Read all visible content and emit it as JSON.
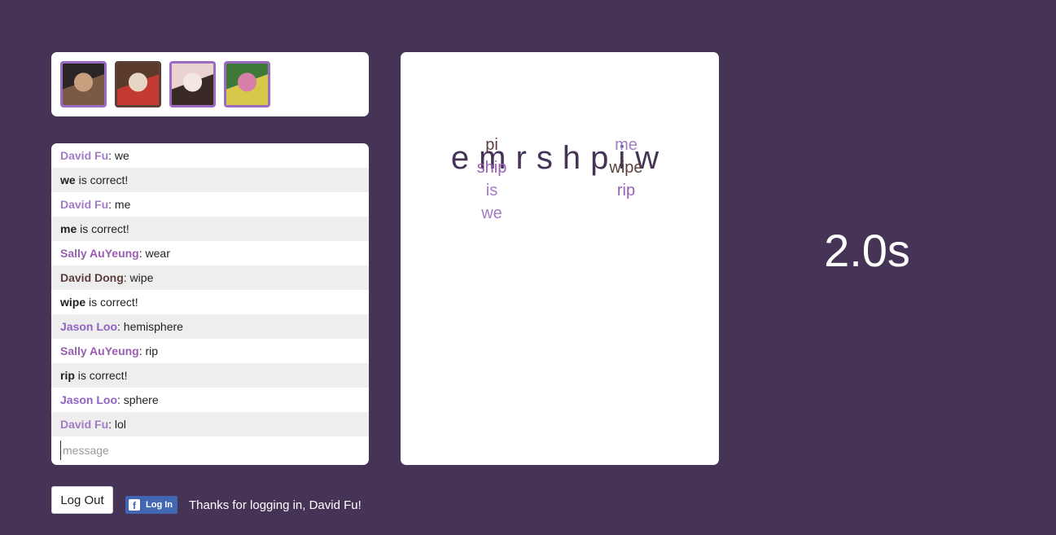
{
  "players": [
    {
      "name": "avatar-1",
      "colors": [
        "#2b2626",
        "#7a5a45",
        "#c9a07e"
      ]
    },
    {
      "name": "avatar-2",
      "colors": [
        "#5a3a2a",
        "#c23a30",
        "#e8d6c4"
      ]
    },
    {
      "name": "avatar-3",
      "colors": [
        "#e9d2cf",
        "#3a2a26",
        "#f3e7e2"
      ]
    },
    {
      "name": "avatar-4",
      "colors": [
        "#3f7a3a",
        "#d8c84a",
        "#d67fa8"
      ]
    }
  ],
  "colors": {
    "background": "#463456",
    "david_fu": "#a27cc7",
    "sally": "#9a5fb2",
    "david_dong": "#5a3f3a",
    "jason": "#8e63c2",
    "letters": "#463456",
    "timer": "#ffffff"
  },
  "chat": {
    "messages": [
      {
        "type": "user",
        "user": "David Fu",
        "sep": ": ",
        "text": "we",
        "color": "#a27cc7"
      },
      {
        "type": "system",
        "word": "we",
        "text": " is correct!"
      },
      {
        "type": "user",
        "user": "David Fu",
        "sep": ": ",
        "text": "me",
        "color": "#a27cc7"
      },
      {
        "type": "system",
        "word": "me",
        "text": " is correct!"
      },
      {
        "type": "user",
        "user": "Sally AuYeung",
        "sep": ": ",
        "text": "wear",
        "color": "#9a5fb2"
      },
      {
        "type": "user",
        "user": "David Dong",
        "sep": ": ",
        "text": "wipe",
        "color": "#5a3f3a"
      },
      {
        "type": "system",
        "word": "wipe",
        "text": " is correct!"
      },
      {
        "type": "user",
        "user": "Jason Loo",
        "sep": ": ",
        "text": "hemisphere",
        "color": "#8e63c2"
      },
      {
        "type": "user",
        "user": "Sally AuYeung",
        "sep": ": ",
        "text": "rip",
        "color": "#9a5fb2"
      },
      {
        "type": "system",
        "word": "rip",
        "text": " is correct!"
      },
      {
        "type": "user",
        "user": "Jason Loo",
        "sep": ": ",
        "text": "sphere",
        "color": "#8e63c2"
      },
      {
        "type": "user",
        "user": "David Fu",
        "sep": ": ",
        "text": "lol",
        "color": "#a27cc7"
      }
    ],
    "input_placeholder": "message",
    "input_value": ""
  },
  "game": {
    "letters": [
      "e",
      "m",
      "r",
      "s",
      "h",
      "p",
      "i",
      "w"
    ],
    "found_words": [
      {
        "word": "pi",
        "color": "#5a3f3a"
      },
      {
        "word": "me",
        "color": "#a27cc7"
      },
      {
        "word": "ship",
        "color": "#9a5fb2"
      },
      {
        "word": "wipe",
        "color": "#5a3f3a"
      },
      {
        "word": "is",
        "color": "#a27cc7"
      },
      {
        "word": "rip",
        "color": "#9a5fb2"
      },
      {
        "word": "we",
        "color": "#a27cc7"
      }
    ]
  },
  "timer": {
    "text": "2.0s"
  },
  "footer": {
    "logout_label": "Log Out",
    "fb_label": "Log In",
    "fb_icon": "f",
    "welcome": "Thanks for logging in, David Fu!"
  }
}
